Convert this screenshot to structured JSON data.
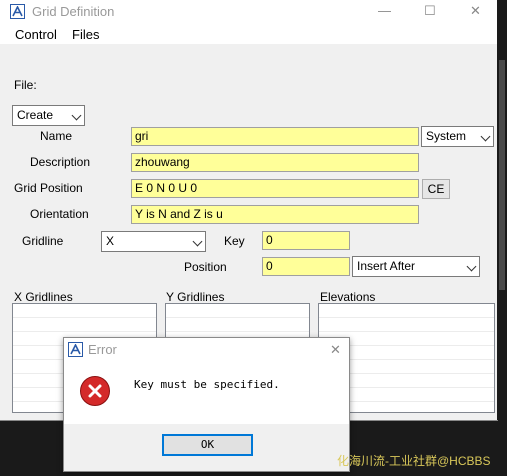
{
  "window": {
    "title": "Grid Definition",
    "minimize": "—",
    "maximize": "☐",
    "close": "✕"
  },
  "menu": {
    "control": "Control",
    "files": "Files"
  },
  "form": {
    "file_label": "File:",
    "mode_select": "Create",
    "name_label": "Name",
    "name_value": "gri",
    "system_select": "System",
    "description_label": "Description",
    "description_value": "zhouwang",
    "grid_position_label": "Grid Position",
    "grid_position_value": "E 0 N 0 U 0",
    "ce_button": "CE",
    "orientation_label": "Orientation",
    "orientation_value": "Y is N and Z is u",
    "gridline_label": "Gridline",
    "gridline_select": "X",
    "key_label": "Key",
    "key_value": "0",
    "position_label": "Position",
    "position_value": "0",
    "insert_select": "Insert After"
  },
  "lists": {
    "x_gridlines": "X Gridlines",
    "y_gridlines": "Y Gridlines",
    "elevations": "Elevations"
  },
  "error_dialog": {
    "title": "Error",
    "close": "✕",
    "message": "Key must be specified.",
    "ok_button": "OK"
  },
  "watermark": "化海川流-工业社群@HCBBS",
  "colors": {
    "field_bg": "#ffff99",
    "window_bg": "#f0f0f0",
    "error_red": "#d42a2a",
    "focus_blue": "#0078d7"
  }
}
